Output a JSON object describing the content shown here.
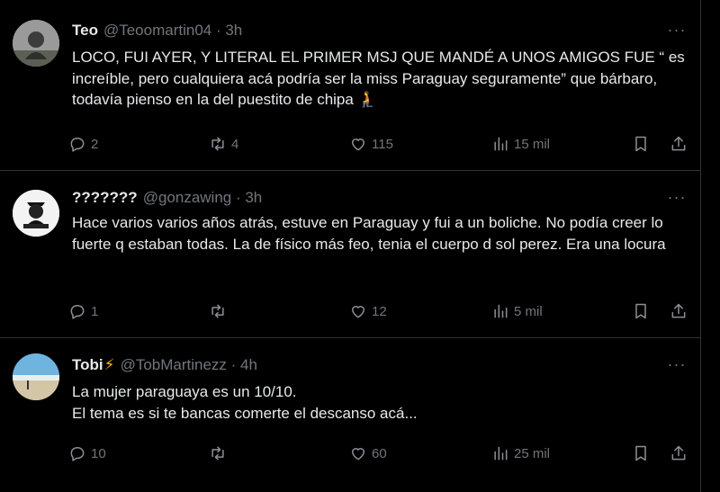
{
  "tweets": [
    {
      "name": "Teo",
      "handle": "@Teoomartin04 · 3h",
      "more": "···",
      "body": "LOCO, FUI AYER, Y LITERAL EL PRIMER MSJ QUE MANDÉ A UNOS AMIGOS FUE “ es increíble, pero cualquiera acá podría ser la miss Paraguay seguramente” que bárbaro, todavía pienso en la del puestito de chipa",
      "emoji": "🧎",
      "replies": "2",
      "reposts": "4",
      "likes": "115",
      "views": "15 mil"
    },
    {
      "name": "???????",
      "handle": "@gonzawing · 3h",
      "more": "···",
      "body": "Hace varios varios años atrás, estuve en Paraguay y fui a un boliche. No podía creer lo fuerte q estaban todas. La de físico más feo, tenia el cuerpo d sol perez. Era una locura",
      "replies": "1",
      "reposts": "",
      "likes": "12",
      "views": "5 mil"
    },
    {
      "name": "Tobi",
      "name_emoji": "⚡",
      "handle": "@TobMartinezz · 4h",
      "more": "···",
      "body_line1": "La mujer paraguaya es un 10/10.",
      "body_line2": "El tema es si te bancas comerte el descanso acá...",
      "replies": "10",
      "reposts": "",
      "likes": "60",
      "views": "25 mil"
    }
  ],
  "icons": [
    "reply-icon",
    "repost-icon",
    "like-icon",
    "views-icon",
    "bookmark-icon",
    "share-icon",
    "more-icon"
  ],
  "colors": {
    "background": "#000000",
    "text": "#e7e9ea",
    "muted": "#71767b",
    "divider": "#2f3336"
  }
}
